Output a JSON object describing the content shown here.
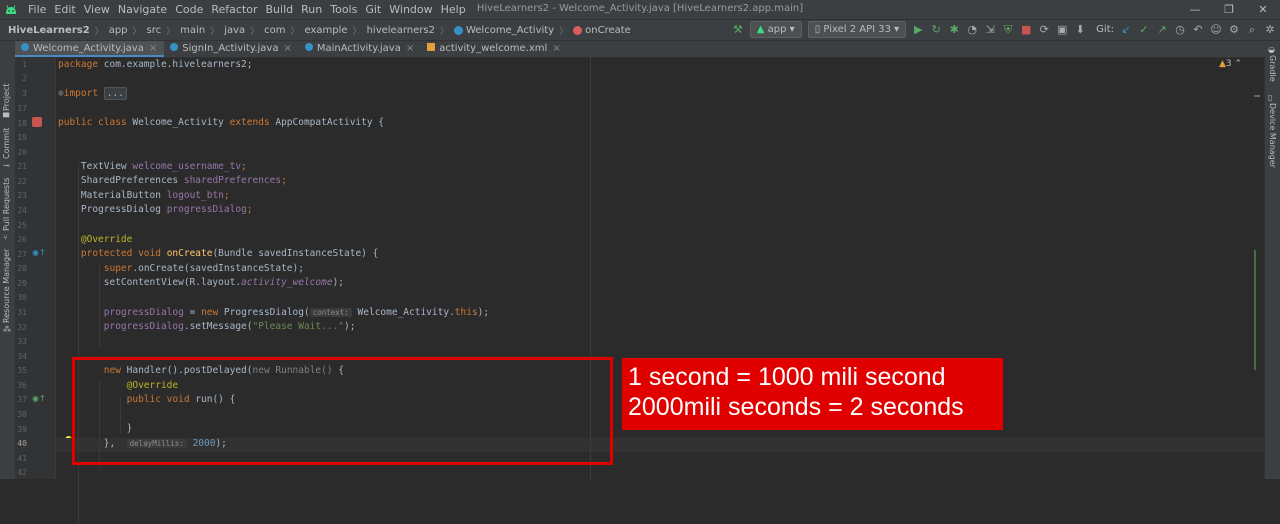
{
  "menubar": {
    "items": [
      "File",
      "Edit",
      "View",
      "Navigate",
      "Code",
      "Refactor",
      "Build",
      "Run",
      "Tools",
      "Git",
      "Window",
      "Help"
    ],
    "window_title": "HiveLearners2 - Welcome_Activity.java [HiveLearners2.app.main]",
    "controls": [
      "—",
      "❐",
      "✕"
    ]
  },
  "navbar": {
    "crumbs": [
      "HiveLearners2",
      "app",
      "src",
      "main",
      "java",
      "com",
      "example",
      "hivelearners2",
      "Welcome_Activity",
      "onCreate"
    ],
    "run_config": "app",
    "device": "Pixel 2 API 33",
    "git_label": "Git:"
  },
  "tabs": [
    {
      "label": "Welcome_Activity.java",
      "active": true
    },
    {
      "label": "SignIn_Activity.java",
      "active": false
    },
    {
      "label": "MainActivity.java",
      "active": false
    },
    {
      "label": "activity_welcome.xml",
      "active": false
    }
  ],
  "side": {
    "left": [
      "Project",
      "Commit",
      "Pull Requests",
      "Resource Manager"
    ],
    "right": [
      "Gradle",
      "Device Manager"
    ]
  },
  "warnings": "3",
  "line_numbers": [
    "1",
    "2",
    "3",
    "17",
    "18",
    "19",
    "20",
    "21",
    "22",
    "23",
    "24",
    "25",
    "26",
    "27",
    "28",
    "29",
    "30",
    "31",
    "32",
    "33",
    "34",
    "35",
    "36",
    "37",
    "38",
    "39",
    "40",
    "41",
    "42"
  ],
  "code": {
    "l1_kw": "package",
    "l1_rest": " com.example.hivelearners2;",
    "l3_kw": "import",
    "l3_fold": "...",
    "l18_a": "public class",
    "l18_b": " Welcome_Activity ",
    "l18_c": "extends",
    "l18_d": " AppCompatActivity {",
    "l21_type": "TextView ",
    "l21_field": "welcome_username_tv",
    "l21_end": ";",
    "l22_type": "SharedPreferences ",
    "l22_field": "sharedPreferences",
    "l22_end": ";",
    "l23_type": "MaterialButton ",
    "l23_field": "logout_btn",
    "l23_end": ";",
    "l24_type": "ProgressDialog ",
    "l24_field": "progressDialog",
    "l24_end": ";",
    "l26_ann": "@Override",
    "l27_kw": "protected void ",
    "l27_fn": "onCreate",
    "l27_rest": "(Bundle savedInstanceState) {",
    "l28_kw": "super",
    "l28_rest": ".onCreate(savedInstanceState);",
    "l29_a": "setContentView(R.layout.",
    "l29_field": "activity_welcome",
    "l29_end": ");",
    "l31_field": "progressDialog",
    "l31_a": " = ",
    "l31_kw": "new",
    "l31_b": " ProgressDialog(",
    "l31_hint": "context:",
    "l31_c": " Welcome_Activity.",
    "l31_this": "this",
    "l31_end": ");",
    "l32_field": "progressDialog",
    "l32_a": ".setMessage(",
    "l32_str": "\"Please Wait...\"",
    "l32_end": ");",
    "l35_kw": "new",
    "l35_a": " Handler().postDelayed(",
    "l35_gray": "new Runnable()",
    "l35_end": " {",
    "l36_ann": "@Override",
    "l37_kw": "public void ",
    "l37_a": "run() {",
    "l39_a": "}",
    "l40_a": "},  ",
    "l40_hint": "delayMillis:",
    "l40_num": " 2000",
    "l40_end": ");"
  },
  "callout": {
    "line1": "1 second = 1000 mili second",
    "line2": "2000mili seconds  = 2 seconds"
  }
}
